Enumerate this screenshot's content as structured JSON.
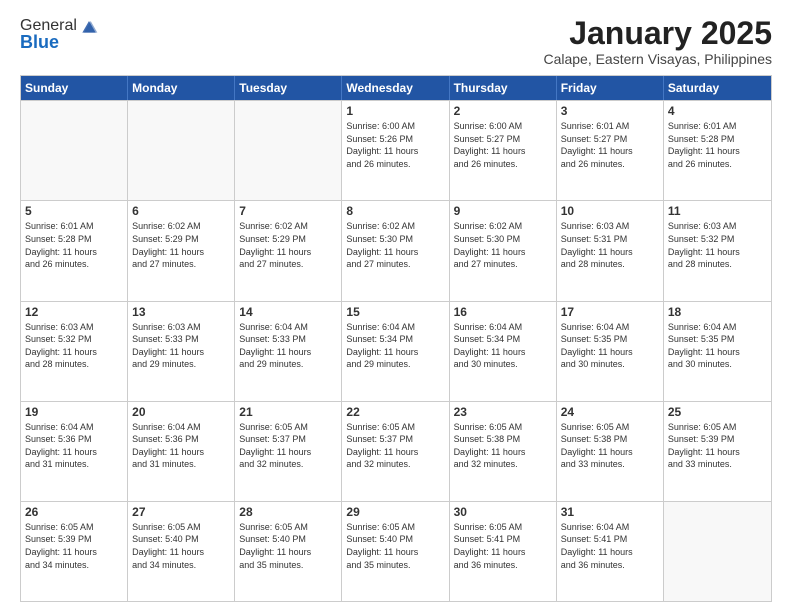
{
  "logo": {
    "general": "General",
    "blue": "Blue"
  },
  "header": {
    "title": "January 2025",
    "subtitle": "Calape, Eastern Visayas, Philippines"
  },
  "weekdays": [
    "Sunday",
    "Monday",
    "Tuesday",
    "Wednesday",
    "Thursday",
    "Friday",
    "Saturday"
  ],
  "weeks": [
    [
      {
        "day": "",
        "text": "",
        "empty": true
      },
      {
        "day": "",
        "text": "",
        "empty": true
      },
      {
        "day": "",
        "text": "",
        "empty": true
      },
      {
        "day": "1",
        "text": "Sunrise: 6:00 AM\nSunset: 5:26 PM\nDaylight: 11 hours\nand 26 minutes.",
        "empty": false
      },
      {
        "day": "2",
        "text": "Sunrise: 6:00 AM\nSunset: 5:27 PM\nDaylight: 11 hours\nand 26 minutes.",
        "empty": false
      },
      {
        "day": "3",
        "text": "Sunrise: 6:01 AM\nSunset: 5:27 PM\nDaylight: 11 hours\nand 26 minutes.",
        "empty": false
      },
      {
        "day": "4",
        "text": "Sunrise: 6:01 AM\nSunset: 5:28 PM\nDaylight: 11 hours\nand 26 minutes.",
        "empty": false
      }
    ],
    [
      {
        "day": "5",
        "text": "Sunrise: 6:01 AM\nSunset: 5:28 PM\nDaylight: 11 hours\nand 26 minutes.",
        "empty": false
      },
      {
        "day": "6",
        "text": "Sunrise: 6:02 AM\nSunset: 5:29 PM\nDaylight: 11 hours\nand 27 minutes.",
        "empty": false
      },
      {
        "day": "7",
        "text": "Sunrise: 6:02 AM\nSunset: 5:29 PM\nDaylight: 11 hours\nand 27 minutes.",
        "empty": false
      },
      {
        "day": "8",
        "text": "Sunrise: 6:02 AM\nSunset: 5:30 PM\nDaylight: 11 hours\nand 27 minutes.",
        "empty": false
      },
      {
        "day": "9",
        "text": "Sunrise: 6:02 AM\nSunset: 5:30 PM\nDaylight: 11 hours\nand 27 minutes.",
        "empty": false
      },
      {
        "day": "10",
        "text": "Sunrise: 6:03 AM\nSunset: 5:31 PM\nDaylight: 11 hours\nand 28 minutes.",
        "empty": false
      },
      {
        "day": "11",
        "text": "Sunrise: 6:03 AM\nSunset: 5:32 PM\nDaylight: 11 hours\nand 28 minutes.",
        "empty": false
      }
    ],
    [
      {
        "day": "12",
        "text": "Sunrise: 6:03 AM\nSunset: 5:32 PM\nDaylight: 11 hours\nand 28 minutes.",
        "empty": false
      },
      {
        "day": "13",
        "text": "Sunrise: 6:03 AM\nSunset: 5:33 PM\nDaylight: 11 hours\nand 29 minutes.",
        "empty": false
      },
      {
        "day": "14",
        "text": "Sunrise: 6:04 AM\nSunset: 5:33 PM\nDaylight: 11 hours\nand 29 minutes.",
        "empty": false
      },
      {
        "day": "15",
        "text": "Sunrise: 6:04 AM\nSunset: 5:34 PM\nDaylight: 11 hours\nand 29 minutes.",
        "empty": false
      },
      {
        "day": "16",
        "text": "Sunrise: 6:04 AM\nSunset: 5:34 PM\nDaylight: 11 hours\nand 30 minutes.",
        "empty": false
      },
      {
        "day": "17",
        "text": "Sunrise: 6:04 AM\nSunset: 5:35 PM\nDaylight: 11 hours\nand 30 minutes.",
        "empty": false
      },
      {
        "day": "18",
        "text": "Sunrise: 6:04 AM\nSunset: 5:35 PM\nDaylight: 11 hours\nand 30 minutes.",
        "empty": false
      }
    ],
    [
      {
        "day": "19",
        "text": "Sunrise: 6:04 AM\nSunset: 5:36 PM\nDaylight: 11 hours\nand 31 minutes.",
        "empty": false
      },
      {
        "day": "20",
        "text": "Sunrise: 6:04 AM\nSunset: 5:36 PM\nDaylight: 11 hours\nand 31 minutes.",
        "empty": false
      },
      {
        "day": "21",
        "text": "Sunrise: 6:05 AM\nSunset: 5:37 PM\nDaylight: 11 hours\nand 32 minutes.",
        "empty": false
      },
      {
        "day": "22",
        "text": "Sunrise: 6:05 AM\nSunset: 5:37 PM\nDaylight: 11 hours\nand 32 minutes.",
        "empty": false
      },
      {
        "day": "23",
        "text": "Sunrise: 6:05 AM\nSunset: 5:38 PM\nDaylight: 11 hours\nand 32 minutes.",
        "empty": false
      },
      {
        "day": "24",
        "text": "Sunrise: 6:05 AM\nSunset: 5:38 PM\nDaylight: 11 hours\nand 33 minutes.",
        "empty": false
      },
      {
        "day": "25",
        "text": "Sunrise: 6:05 AM\nSunset: 5:39 PM\nDaylight: 11 hours\nand 33 minutes.",
        "empty": false
      }
    ],
    [
      {
        "day": "26",
        "text": "Sunrise: 6:05 AM\nSunset: 5:39 PM\nDaylight: 11 hours\nand 34 minutes.",
        "empty": false
      },
      {
        "day": "27",
        "text": "Sunrise: 6:05 AM\nSunset: 5:40 PM\nDaylight: 11 hours\nand 34 minutes.",
        "empty": false
      },
      {
        "day": "28",
        "text": "Sunrise: 6:05 AM\nSunset: 5:40 PM\nDaylight: 11 hours\nand 35 minutes.",
        "empty": false
      },
      {
        "day": "29",
        "text": "Sunrise: 6:05 AM\nSunset: 5:40 PM\nDaylight: 11 hours\nand 35 minutes.",
        "empty": false
      },
      {
        "day": "30",
        "text": "Sunrise: 6:05 AM\nSunset: 5:41 PM\nDaylight: 11 hours\nand 36 minutes.",
        "empty": false
      },
      {
        "day": "31",
        "text": "Sunrise: 6:04 AM\nSunset: 5:41 PM\nDaylight: 11 hours\nand 36 minutes.",
        "empty": false
      },
      {
        "day": "",
        "text": "",
        "empty": true
      }
    ]
  ]
}
